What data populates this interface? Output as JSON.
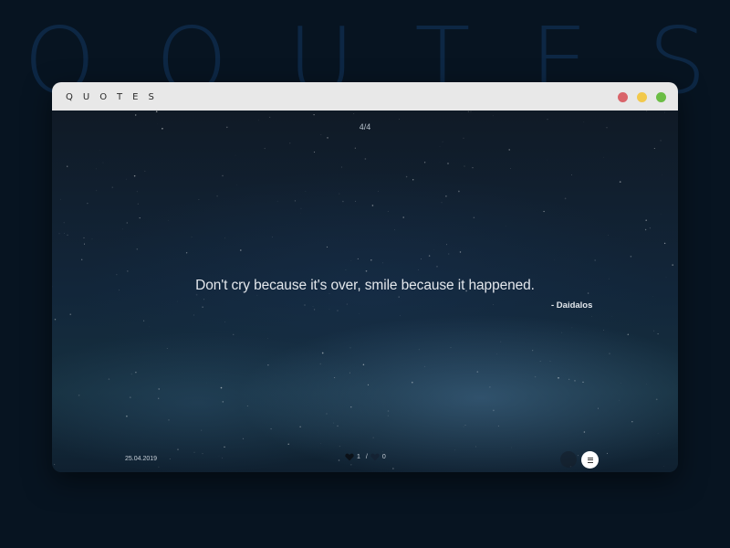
{
  "background_title": "QOUTES",
  "window": {
    "title": "QUOTES",
    "controls": [
      "close",
      "minimize",
      "maximize"
    ],
    "colors": {
      "close": "#d9646a",
      "minimize": "#f2c94c",
      "maximize": "#6bbd45"
    }
  },
  "quote": {
    "counter": "4/4",
    "text": "Don't cry because it's over, smile because it happened.",
    "author": "- Daidalos",
    "date": "25.04.2019"
  },
  "votes": {
    "likes": "1",
    "separator": "/",
    "dislikes": "0",
    "like_icon": "heart-icon",
    "dislike_icon": "broken-heart-icon"
  },
  "footer": {
    "menu_icon": "menu-icon"
  }
}
